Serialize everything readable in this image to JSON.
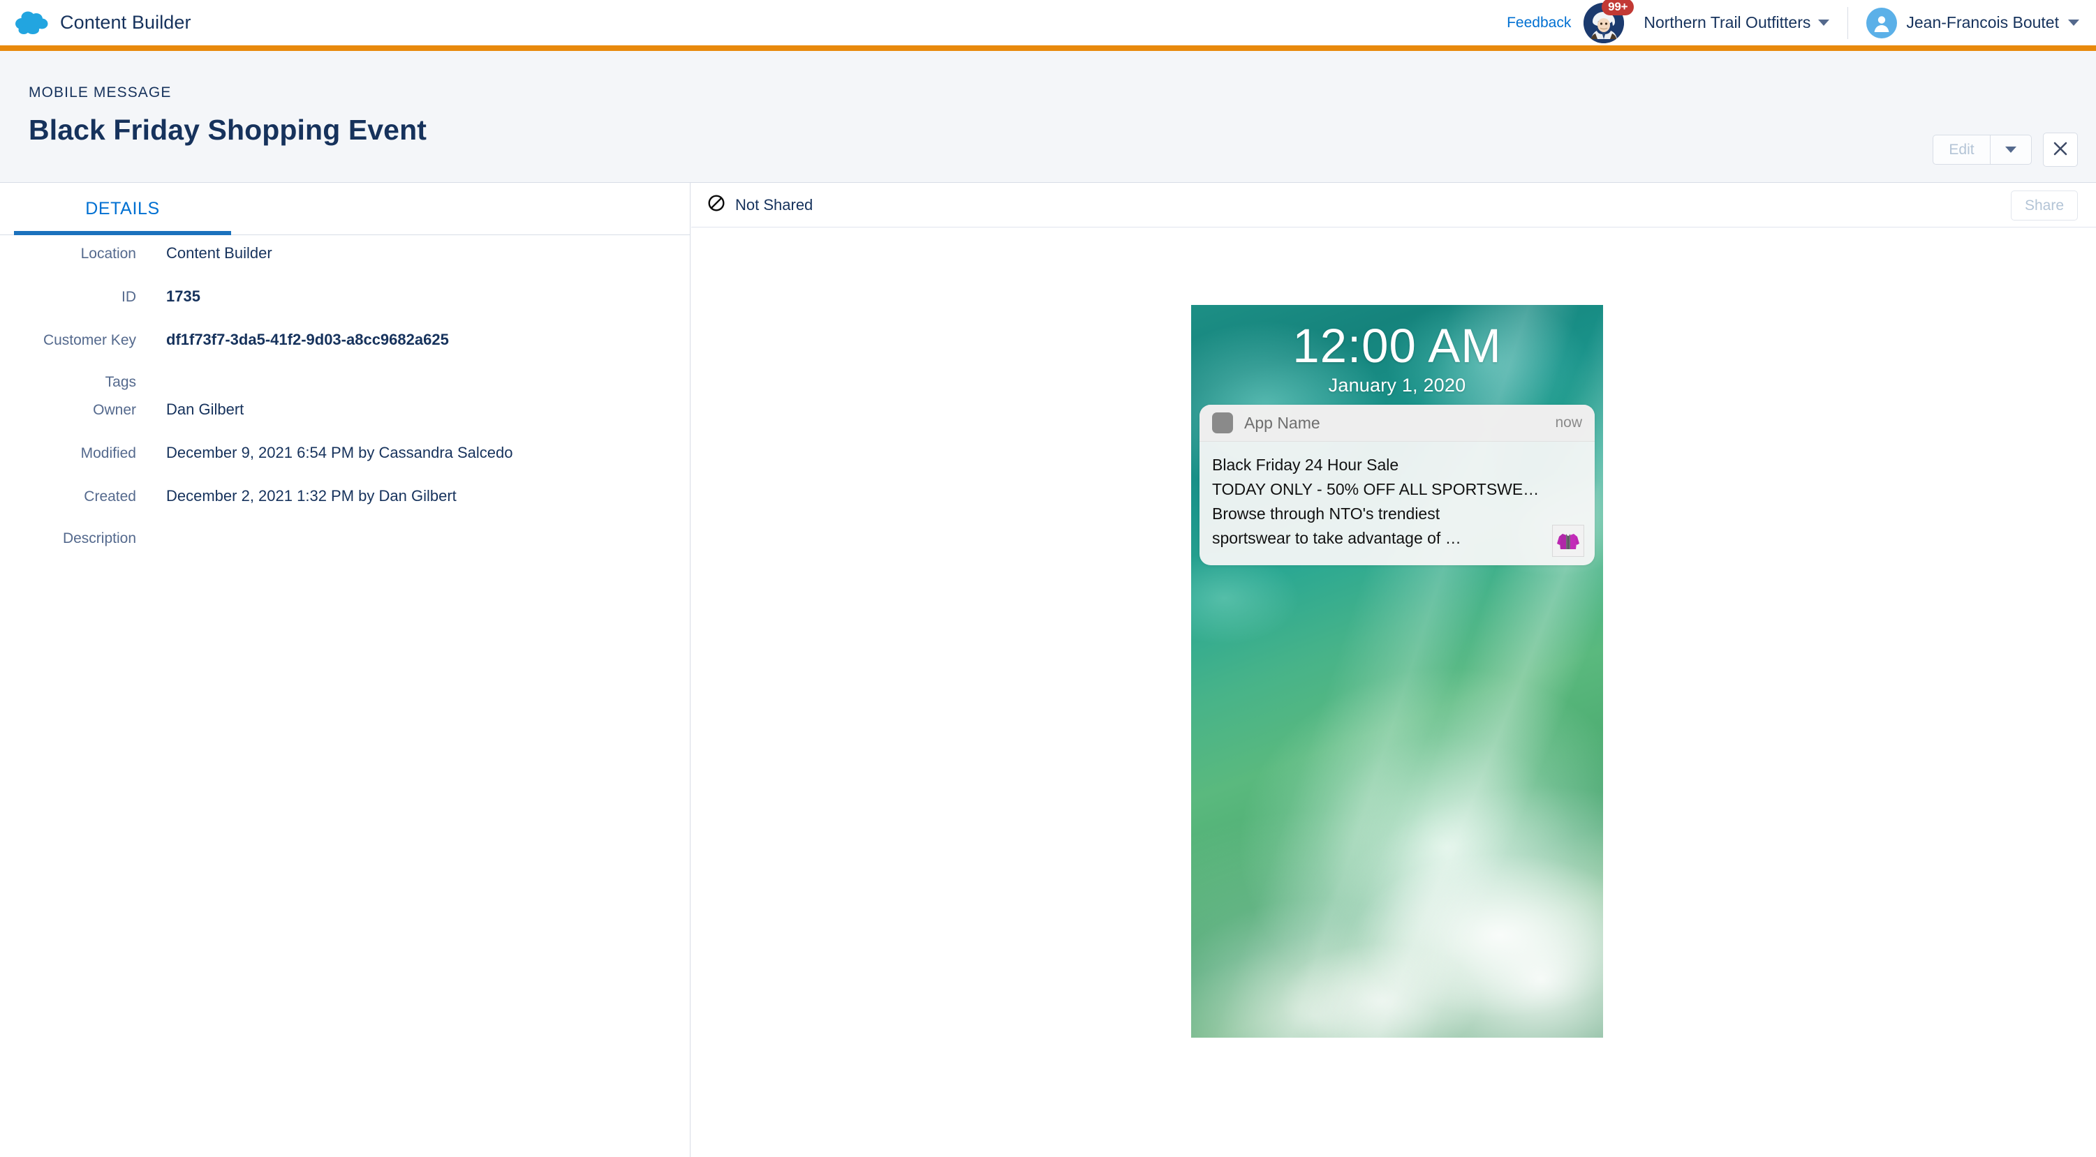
{
  "header": {
    "logo_icon": "salesforce-cloud-icon",
    "app_title": "Content Builder",
    "feedback_label": "Feedback",
    "einstein_icon": "einstein-avatar-icon",
    "einstein_badge": "99+",
    "org_name": "Northern Trail Outfitters",
    "org_caret_icon": "chevron-down-icon",
    "user_avatar_icon": "user-avatar-icon",
    "user_name": "Jean-Francois Boutet",
    "user_caret_icon": "chevron-down-icon",
    "accent_color": "#e8890c"
  },
  "record": {
    "eyebrow": "MOBILE MESSAGE",
    "title": "Black Friday Shopping Event",
    "edit_label": "Edit",
    "edit_menu_icon": "chevron-down-icon",
    "close_icon": "close-icon"
  },
  "details": {
    "tab_label": "DETAILS",
    "tab_active_color": "#1b72bd",
    "fields": [
      {
        "label": "Location",
        "value": "Content Builder"
      },
      {
        "label": "ID",
        "value": "1735"
      },
      {
        "label": "Customer Key",
        "value": "df1f73f7-3da5-41f2-9d03-a8cc9682a625"
      },
      {
        "label": "Tags",
        "value": ""
      },
      {
        "label": "Owner",
        "value": "Dan Gilbert"
      },
      {
        "label": "Modified",
        "value": "December 9, 2021 6:54 PM by Cassandra Salcedo"
      },
      {
        "label": "Created",
        "value": "December 2, 2021 1:32 PM by Dan Gilbert"
      },
      {
        "label": "Description",
        "value": ""
      }
    ]
  },
  "preview": {
    "share_status_icon": "not-shared-icon",
    "share_status_label": "Not Shared",
    "share_button_label": "Share",
    "phone": {
      "wallpaper_icon": "ocean-wave-wallpaper",
      "lock_time": "12:00 AM",
      "lock_date": "January 1, 2020",
      "notification": {
        "app_icon": "app-placeholder-icon",
        "app_name": "App Name",
        "timestamp": "now",
        "lines": [
          "Black Friday 24 Hour Sale",
          "TODAY ONLY - 50% OFF ALL SPORTSWE…",
          "Browse through NTO's trendiest",
          "sportswear to take advantage of …"
        ],
        "thumbnail_icon": "purple-jacket-thumbnail"
      }
    }
  }
}
